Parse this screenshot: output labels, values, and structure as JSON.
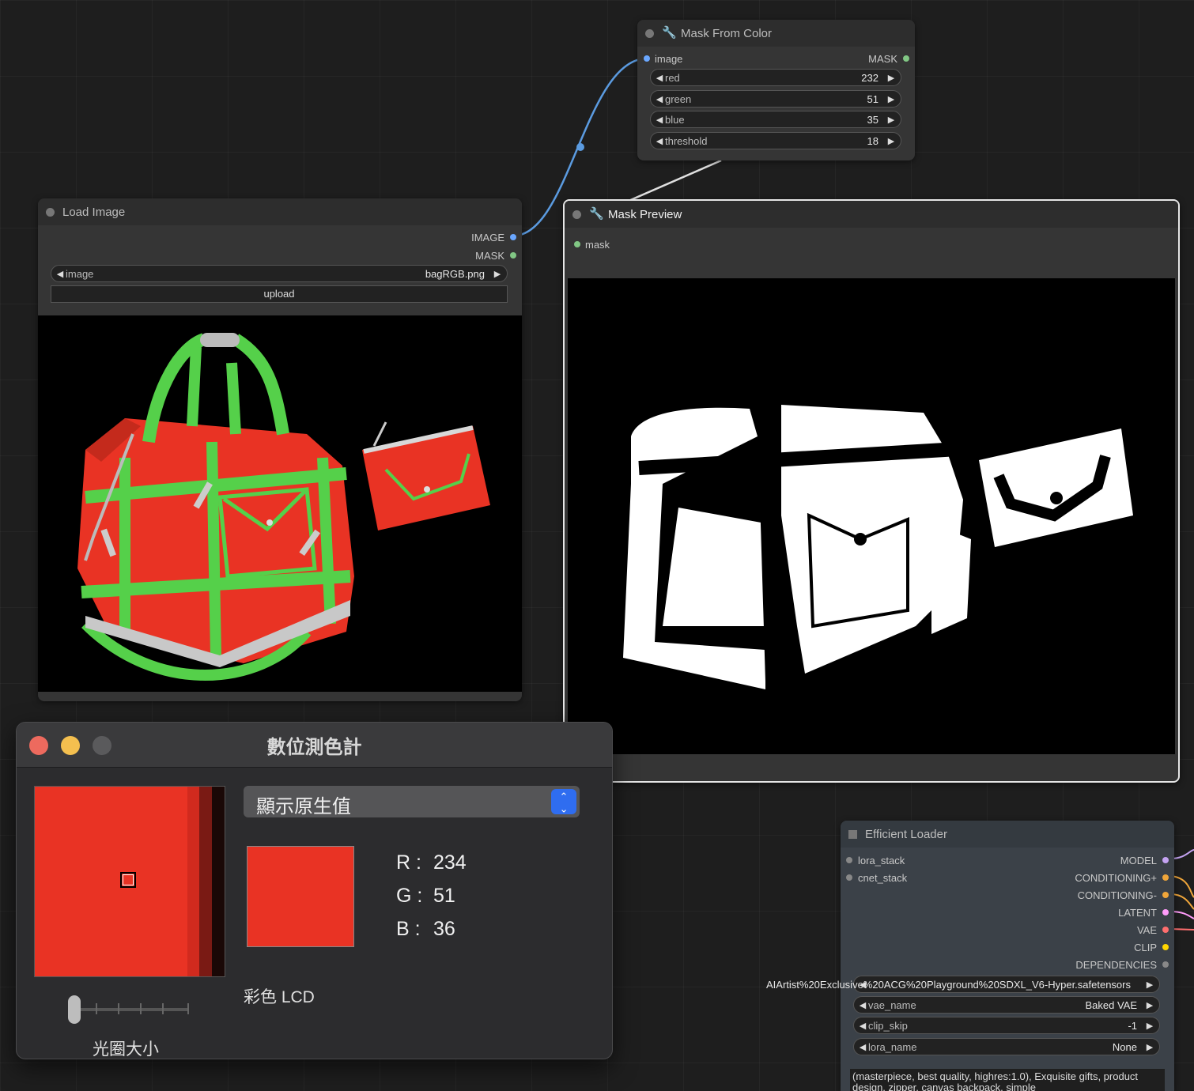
{
  "mask_from_color": {
    "title": "Mask From Color",
    "input_label": "image",
    "output_label": "MASK",
    "widgets": [
      {
        "label": "red",
        "value": "232"
      },
      {
        "label": "green",
        "value": "51"
      },
      {
        "label": "blue",
        "value": "35"
      },
      {
        "label": "threshold",
        "value": "18"
      }
    ]
  },
  "load_image": {
    "title": "Load Image",
    "outputs": [
      "IMAGE",
      "MASK"
    ],
    "image_widget": {
      "label": "image",
      "value": "bagRGB.png"
    },
    "upload_label": "upload"
  },
  "mask_preview": {
    "title": "Mask Preview",
    "input_label": "mask"
  },
  "efficient_loader": {
    "title": "Efficient Loader",
    "inputs": [
      "lora_stack",
      "cnet_stack"
    ],
    "outputs": [
      {
        "label": "MODEL",
        "color": "#c4a3f2"
      },
      {
        "label": "CONDITIONING+",
        "color": "#f0a63a"
      },
      {
        "label": "CONDITIONING-",
        "color": "#f0a63a"
      },
      {
        "label": "LATENT",
        "color": "#ff9cf9"
      },
      {
        "label": "VAE",
        "color": "#ff6e6e"
      },
      {
        "label": "CLIP",
        "color": "#ffd500"
      },
      {
        "label": "DEPENDENCIES",
        "color": "#888888"
      }
    ],
    "ckpt_value": "AIArtist%20Exclusive%20ACG%20Playground%20SDXL_V6-Hyper.safetensors",
    "widgets": [
      {
        "label": "vae_name",
        "value": "Baked VAE"
      },
      {
        "label": "clip_skip",
        "value": "-1"
      },
      {
        "label": "lora_name",
        "value": "None"
      }
    ],
    "prompt_text": "(masterpiece, best quality, highres:1.0), Exquisite gifts, product design, zipper, canvas backpack, simple"
  },
  "color_meter": {
    "title": "數位測色計",
    "dropdown_value": "顯示原生值",
    "r_label": "R :",
    "r_value": "234",
    "g_label": "G :",
    "g_value": "51",
    "b_label": "B :",
    "b_value": "36",
    "display_label": "彩色 LCD",
    "aperture_label": "光圈大小",
    "sample_color": "#e93324"
  },
  "colors": {
    "image_slot": "#6aa7ff",
    "mask_slot": "#81c784",
    "wire_image": "#5b9be0",
    "wire_mask": "#e0e0e0"
  }
}
